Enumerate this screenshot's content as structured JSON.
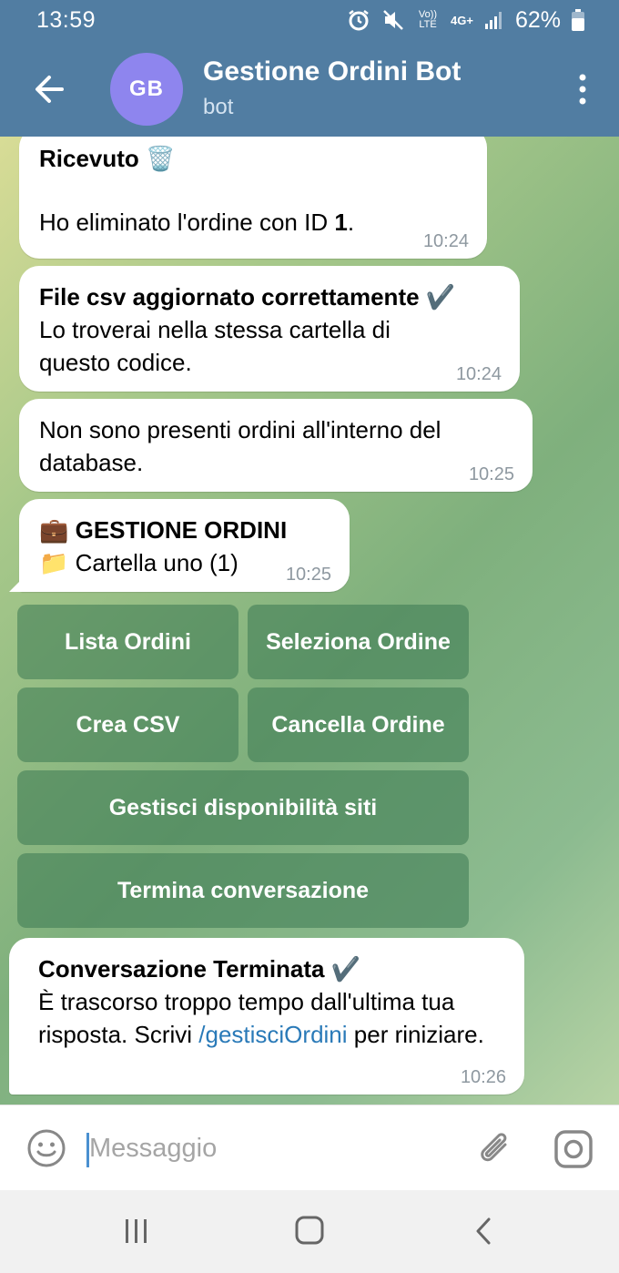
{
  "status_bar": {
    "time": "13:59",
    "volte": "Vo)) LTE",
    "network": "4G+",
    "battery_percent": "62%",
    "icons": [
      "alarm-icon",
      "mute-icon",
      "volte-icon",
      "data-4g-icon",
      "signal-icon",
      "battery-icon"
    ]
  },
  "header": {
    "avatar_initials": "GB",
    "avatar_color": "#8e85ee",
    "title": "Gestione Ordini Bot",
    "subtitle": "bot",
    "accent_color": "#517da2"
  },
  "messages": [
    {
      "title": "Ricevuto 🗑️",
      "text_prefix": "Ho eliminato l'ordine con ID ",
      "text_bold": "1",
      "text_suffix": ".",
      "time": "10:24"
    },
    {
      "title": "File csv aggiornato correttamente ✔️",
      "text": "Lo troverai nella stessa cartella di questo codice.",
      "time": "10:24"
    },
    {
      "text": "Non sono presenti ordini all'interno del database.",
      "time": "10:25"
    },
    {
      "title": "💼 GESTIONE ORDINI",
      "text": "📁 Cartella uno (1)",
      "time": "10:25"
    },
    {
      "title": "Conversazione Terminata ✔️",
      "text_prefix": "È trascorso troppo tempo dall'ultima tua risposta. Scrivi ",
      "link": "/gestisciOrdini",
      "text_suffix": " per riniziare.",
      "time": "10:26"
    }
  ],
  "keyboard": {
    "buttons": [
      "Lista Ordini",
      "Seleziona Ordine",
      "Crea CSV",
      "Cancella Ordine",
      "Gestisci disponibilità siti",
      "Termina conversazione"
    ]
  },
  "input": {
    "placeholder": "Messaggio",
    "value": ""
  },
  "navigation": {
    "icons": [
      "recent-apps-icon",
      "home-icon",
      "back-icon"
    ]
  }
}
